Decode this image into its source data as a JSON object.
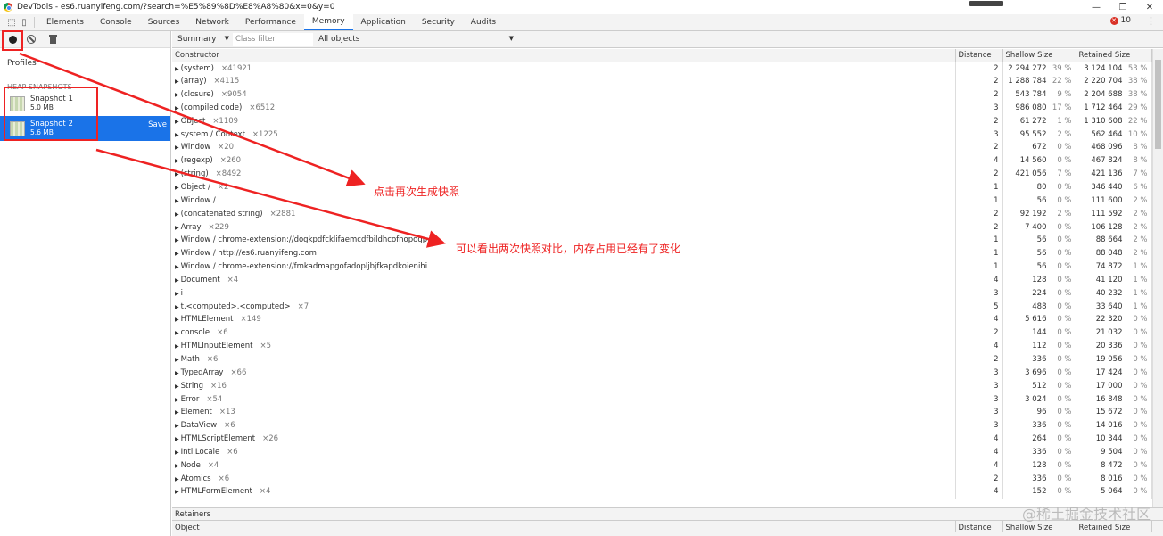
{
  "window": {
    "title": "DevTools - es6.ruanyifeng.com/?search=%E5%89%8D%E8%A8%80&x=0&y=0",
    "controls": [
      "—",
      "❐",
      "✕"
    ]
  },
  "tabs": [
    {
      "label": "Elements"
    },
    {
      "label": "Console"
    },
    {
      "label": "Sources"
    },
    {
      "label": "Network"
    },
    {
      "label": "Performance"
    },
    {
      "label": "Memory",
      "active": true
    },
    {
      "label": "Application"
    },
    {
      "label": "Security"
    },
    {
      "label": "Audits"
    }
  ],
  "error_count": "10",
  "left": {
    "profiles_label": "Profiles",
    "heap_header": "HEAP SNAPSHOTS",
    "snapshots": [
      {
        "name": "Snapshot 1",
        "size": "5.0 MB"
      },
      {
        "name": "Snapshot 2",
        "size": "5.6 MB",
        "action": "Save"
      }
    ]
  },
  "toolbar": {
    "view": "Summary",
    "class_filter_placeholder": "Class filter",
    "objects": "All objects"
  },
  "columns": [
    "Constructor",
    "Distance",
    "Shallow Size",
    "Retained Size"
  ],
  "rows": [
    [
      "(system)",
      "×41921",
      "2",
      "2 294 272",
      "39 %",
      "3 124 104",
      "53 %"
    ],
    [
      "(array)",
      "×4115",
      "2",
      "1 288 784",
      "22 %",
      "2 220 704",
      "38 %"
    ],
    [
      "(closure)",
      "×9054",
      "2",
      "543 784",
      "9 %",
      "2 204 688",
      "38 %"
    ],
    [
      "(compiled code)",
      "×6512",
      "3",
      "986 080",
      "17 %",
      "1 712 464",
      "29 %"
    ],
    [
      "Object",
      "×1109",
      "2",
      "61 272",
      "1 %",
      "1 310 608",
      "22 %"
    ],
    [
      "system / Context",
      "×1225",
      "3",
      "95 552",
      "2 %",
      "562 464",
      "10 %"
    ],
    [
      "Window",
      "×20",
      "2",
      "672",
      "0 %",
      "468 096",
      "8 %"
    ],
    [
      "(regexp)",
      "×260",
      "4",
      "14 560",
      "0 %",
      "467 824",
      "8 %"
    ],
    [
      "(string)",
      "×8492",
      "2",
      "421 056",
      "7 %",
      "421 136",
      "7 %"
    ],
    [
      "Object /",
      "×2",
      "1",
      "80",
      "0 %",
      "346 440",
      "6 %"
    ],
    [
      "Window /",
      "",
      "1",
      "56",
      "0 %",
      "111 600",
      "2 %"
    ],
    [
      "(concatenated string)",
      "×2881",
      "2",
      "92 192",
      "2 %",
      "111 592",
      "2 %"
    ],
    [
      "Array",
      "×229",
      "2",
      "7 400",
      "0 %",
      "106 128",
      "2 %"
    ],
    [
      "Window / chrome-extension://dogkpdfcklifaemcdfbildhcofnopogp",
      "",
      "1",
      "56",
      "0 %",
      "88 664",
      "2 %"
    ],
    [
      "Window / http://es6.ruanyifeng.com",
      "",
      "1",
      "56",
      "0 %",
      "88 048",
      "2 %"
    ],
    [
      "Window / chrome-extension://fmkadmapgofadopljbjfkapdkoienihi",
      "",
      "1",
      "56",
      "0 %",
      "74 872",
      "1 %"
    ],
    [
      "Document",
      "×4",
      "4",
      "128",
      "0 %",
      "41 120",
      "1 %"
    ],
    [
      "i",
      "",
      "3",
      "224",
      "0 %",
      "40 232",
      "1 %"
    ],
    [
      "t.<computed>.<computed>",
      "×7",
      "5",
      "488",
      "0 %",
      "33 640",
      "1 %"
    ],
    [
      "HTMLElement",
      "×149",
      "4",
      "5 616",
      "0 %",
      "22 320",
      "0 %"
    ],
    [
      "console",
      "×6",
      "2",
      "144",
      "0 %",
      "21 032",
      "0 %"
    ],
    [
      "HTMLInputElement",
      "×5",
      "4",
      "112",
      "0 %",
      "20 336",
      "0 %"
    ],
    [
      "Math",
      "×6",
      "2",
      "336",
      "0 %",
      "19 056",
      "0 %"
    ],
    [
      "TypedArray",
      "×66",
      "3",
      "3 696",
      "0 %",
      "17 424",
      "0 %"
    ],
    [
      "String",
      "×16",
      "3",
      "512",
      "0 %",
      "17 000",
      "0 %"
    ],
    [
      "Error",
      "×54",
      "3",
      "3 024",
      "0 %",
      "16 848",
      "0 %"
    ],
    [
      "Element",
      "×13",
      "3",
      "96",
      "0 %",
      "15 672",
      "0 %"
    ],
    [
      "DataView",
      "×6",
      "3",
      "336",
      "0 %",
      "14 016",
      "0 %"
    ],
    [
      "HTMLScriptElement",
      "×26",
      "4",
      "264",
      "0 %",
      "10 344",
      "0 %"
    ],
    [
      "Intl.Locale",
      "×6",
      "4",
      "336",
      "0 %",
      "9 504",
      "0 %"
    ],
    [
      "Node",
      "×4",
      "4",
      "128",
      "0 %",
      "8 472",
      "0 %"
    ],
    [
      "Atomics",
      "×6",
      "2",
      "336",
      "0 %",
      "8 016",
      "0 %"
    ],
    [
      "HTMLFormElement",
      "×4",
      "4",
      "152",
      "0 %",
      "5 064",
      "0 %"
    ]
  ],
  "retainers": {
    "title": "Retainers",
    "columns": [
      "Object",
      "Distance",
      "Shallow Size",
      "Retained Size"
    ]
  },
  "annotations": {
    "note1": "点击再次生成快照",
    "note2": "可以看出两次快照对比，内存占用已经有了变化",
    "color": "#e22222"
  },
  "watermark": "@稀土掘金技术社区"
}
